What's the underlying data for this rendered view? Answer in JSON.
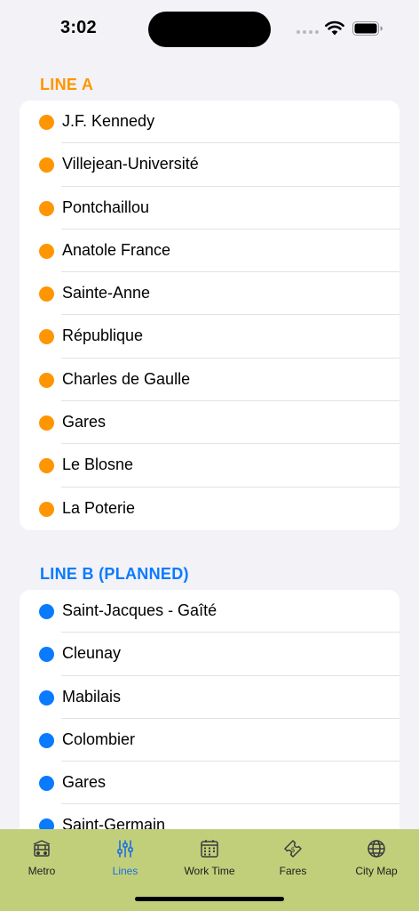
{
  "status_bar": {
    "time": "3:02"
  },
  "colors": {
    "line_a": "#ff9500",
    "line_b": "#0a7aff",
    "tab_bar": "#c2cf7a",
    "tab_active": "#1a6fe0"
  },
  "line_a": {
    "title": "LINE A",
    "stations": [
      "J.F. Kennedy",
      "Villejean-Université",
      "Pontchaillou",
      "Anatole France",
      "Sainte-Anne",
      "République",
      "Charles de Gaulle",
      "Gares",
      "Le Blosne",
      "La Poterie"
    ]
  },
  "line_b": {
    "title": "LINE B (PLANNED)",
    "stations": [
      "Saint-Jacques - Gaîté",
      "Cleunay",
      "Mabilais",
      "Colombier",
      "Gares",
      "Saint-Germain"
    ]
  },
  "tab_bar": {
    "tabs": [
      {
        "label": "Metro",
        "icon": "tram-icon"
      },
      {
        "label": "Lines",
        "icon": "sliders-icon"
      },
      {
        "label": "Work Time",
        "icon": "calendar-icon"
      },
      {
        "label": "Fares",
        "icon": "ticket-icon"
      },
      {
        "label": "City Map",
        "icon": "globe-icon"
      }
    ],
    "active": "Lines"
  }
}
